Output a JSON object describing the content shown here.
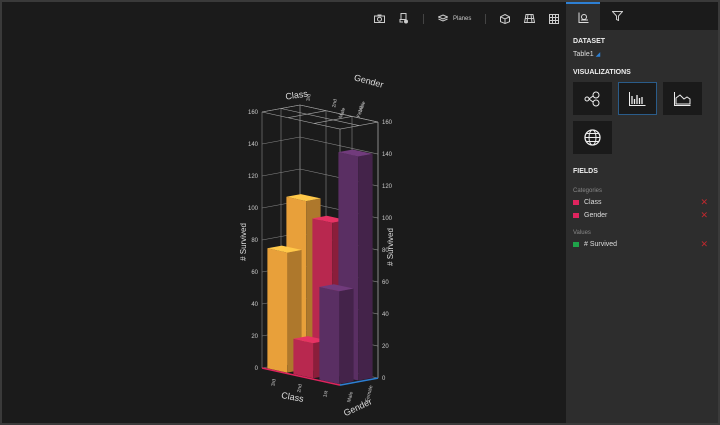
{
  "toolbar": {
    "planes_label": "Planes",
    "icons": [
      "camera-icon",
      "export-icon",
      "planes-icon",
      "cube-icon",
      "perspective-grid-icon",
      "grid-icon"
    ]
  },
  "panel": {
    "tabs": [
      "chart-settings-icon",
      "filter-icon"
    ],
    "dataset_heading": "DATASET",
    "dataset_value": "Table1",
    "visualizations_heading": "VISUALIZATIONS",
    "visualizations": [
      "network-graph",
      "bar-chart",
      "area-chart",
      "globe-map"
    ],
    "selected_visualization": "bar-chart",
    "fields_heading": "FIELDS",
    "categories_heading": "Categories",
    "categories": [
      {
        "name": "Class",
        "color": "#e0245e"
      },
      {
        "name": "Gender",
        "color": "#e0245e"
      }
    ],
    "values_heading": "Values",
    "values": [
      {
        "name": "# Survived",
        "color": "#1fa34a"
      }
    ]
  },
  "chart_data": {
    "type": "bar3d",
    "x_title": "Class",
    "x_categories": [
      "3rd",
      "2nd",
      "1st"
    ],
    "z_title": "Gender",
    "z_categories": [
      "Male",
      "Female"
    ],
    "ylabel": "# Survived",
    "ylim": [
      0,
      160
    ],
    "yticks": [
      0,
      20,
      40,
      60,
      80,
      100,
      120,
      140,
      160
    ],
    "series_colors": {
      "3rd": "#e8a03a",
      "2nd": "#b8284f",
      "1st": "#5a2f63"
    },
    "values": {
      "3rd": [
        75,
        105
      ],
      "2nd": [
        22,
        95
      ],
      "1st": [
        58,
        140
      ]
    },
    "grid": true
  }
}
